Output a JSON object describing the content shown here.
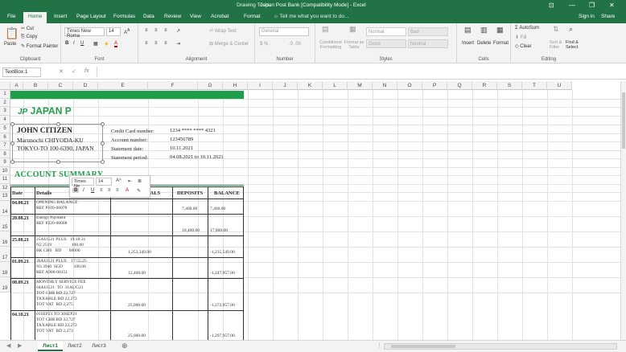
{
  "window": {
    "title": "Japan Post Bank [Compatibility Mode] - Excel",
    "context_tab_group": "Drawing Tools",
    "controls": [
      "⊡",
      "—",
      "❐",
      "✕"
    ]
  },
  "tabs": [
    "File",
    "Home",
    "Insert",
    "Page Layout",
    "Formulas",
    "Data",
    "Review",
    "View",
    "Acrobat",
    "Format"
  ],
  "tell_me": "Tell me what you want to do...",
  "sign_in": "Sign in",
  "share": "Share",
  "ribbon": {
    "clipboard": {
      "label": "Clipboard",
      "paste": "Paste",
      "cut": "Cut",
      "copy": "Copy",
      "format_painter": "Format Painter"
    },
    "font": {
      "label": "Font",
      "family": "Times New Roma",
      "size": "14"
    },
    "alignment": {
      "label": "Alignment",
      "wrap": "Wrap Text",
      "merge": "Merge & Center"
    },
    "number": {
      "label": "Number",
      "format": "General"
    },
    "styles": {
      "label": "Styles",
      "conditional": "Conditional Formatting",
      "format_table": "Format as Table",
      "normal": "Normal",
      "bad": "Bad",
      "good": "Good",
      "neutral": "Neutral"
    },
    "cells": {
      "label": "Cells",
      "insert": "Insert",
      "delete": "Delete",
      "format": "Format"
    },
    "editing": {
      "label": "Editing",
      "autosum": "AutoSum",
      "fill": "Fill",
      "clear": "Clear",
      "sort": "Sort & Filter",
      "find": "Find & Select"
    }
  },
  "formula_bar": {
    "name_box": "TextBox 1",
    "fx": "fx",
    "value": ""
  },
  "columns": [
    "A",
    "B",
    "C",
    "D",
    "E",
    "F",
    "G",
    "H",
    "I",
    "J",
    "K",
    "L",
    "M",
    "N",
    "O",
    "P",
    "Q",
    "R",
    "S",
    "T",
    "U"
  ],
  "rows": [
    "1",
    "2",
    "3",
    "4",
    "5",
    "6",
    "7",
    "8",
    "9",
    "10",
    "11",
    "12",
    "13",
    "14",
    "15",
    "16",
    "17",
    "18",
    "19"
  ],
  "floating_toolbar": {
    "font": "Times Ne",
    "size": "14"
  },
  "document": {
    "bank_logo_mark": "JP",
    "bank_name": "JAPAN P",
    "customer_name": "JOHN CITIZEN",
    "address_line1": "Marunochi CHIYODA-KU",
    "address_line2": "TOKYO-TO 100-6390, JAPAN",
    "info": [
      {
        "label": "Credit Card number:",
        "value": "1234 **** **** 4321"
      },
      {
        "label": "Account number:",
        "value": "123456789"
      },
      {
        "label": "Statement date:",
        "value": "10.11.2021"
      },
      {
        "label": "Statement period:",
        "value": "04.08.2021 to 10.11.2021"
      }
    ],
    "section_title": "ACCOUNT SUMMARY",
    "table_headers": {
      "date": "Date",
      "details": "Details",
      "withdrawals": "WITHDRAWALS",
      "deposits": "DEPOSITS",
      "balance": "BALANCE"
    },
    "transactions": [
      {
        "date": "04.08.21",
        "details": "OPENING BALANCE\nREF P109-00078",
        "withdrawal": "",
        "deposit": "7,400.00",
        "balance": "7,400.00"
      },
      {
        "date": "20.08.21",
        "details": "Energy Payment\nREF P220-00008",
        "withdrawal": "",
        "deposit": "10,400.00",
        "balance": "17,800.00"
      },
      {
        "date": "25.08.21",
        "details": "25AUG21 PLUS   19:18:31\nN2 2519                  100.00\nBK CH0   BD       60000",
        "withdrawal": "1,253,349.00",
        "deposit": "",
        "balance": "-1,235,549.00"
      },
      {
        "date": "01.09.21",
        "details": "30AUG21 PLUS    17:55:25\nN3 3940  SGD          100.00\nREF A900-00151",
        "withdrawal": "12,408.00",
        "deposit": "",
        "balance": "-1,247,957.00"
      },
      {
        "date": "08.09.21",
        "details": "MONTHLY SERVICE FEE\n04AUG21  TO  31AUG21\nTOT CHR BD 22,727\nTAXABLE BD 22,272\nTOT VAT  BD 2,275",
        "withdrawal": "25,000.00",
        "deposit": "",
        "balance": "-1,272,957.00"
      },
      {
        "date": "04.10.21",
        "details": "01SEP21 TO 30SEP21\nTOT CHR BD 22,727\nTAXABLE BD 22,272\nTOT VAT  BD 2,273",
        "withdrawal": "25,000.00",
        "deposit": "",
        "balance": "-1,297,957.00"
      }
    ]
  },
  "sheets": [
    "Лист1",
    "Лист2",
    "Лист3"
  ]
}
